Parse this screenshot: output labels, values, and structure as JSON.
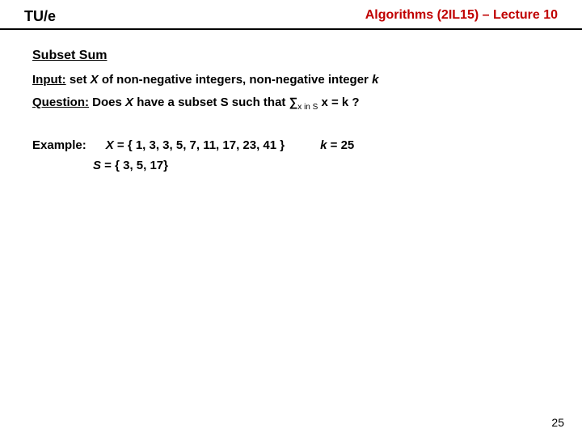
{
  "header": {
    "left": "TU/e",
    "right": "Algorithms (2IL15) – Lecture 10"
  },
  "title": "Subset Sum",
  "input": {
    "label": "Input:",
    "text_before_X": " set ",
    "X": "X",
    "text_after_X": " of non-negative integers, non-negative integer ",
    "k": "k"
  },
  "question": {
    "label": "Question:",
    "prefix": " Does ",
    "X": "X",
    "mid": " have a subset S such that ",
    "sum": "∑",
    "sub": "x in S",
    "eq": " x = k  ?"
  },
  "example": {
    "label": "Example:",
    "X_lead": "X",
    "X_rest": " = { 1, 3, 3, 5, 7, 11, 17, 23, 41 }",
    "k_lead": "k",
    "k_rest": " = 25",
    "S_lead": "S",
    "S_rest": " = { 3, 5, 17}"
  },
  "pagenum": "25"
}
